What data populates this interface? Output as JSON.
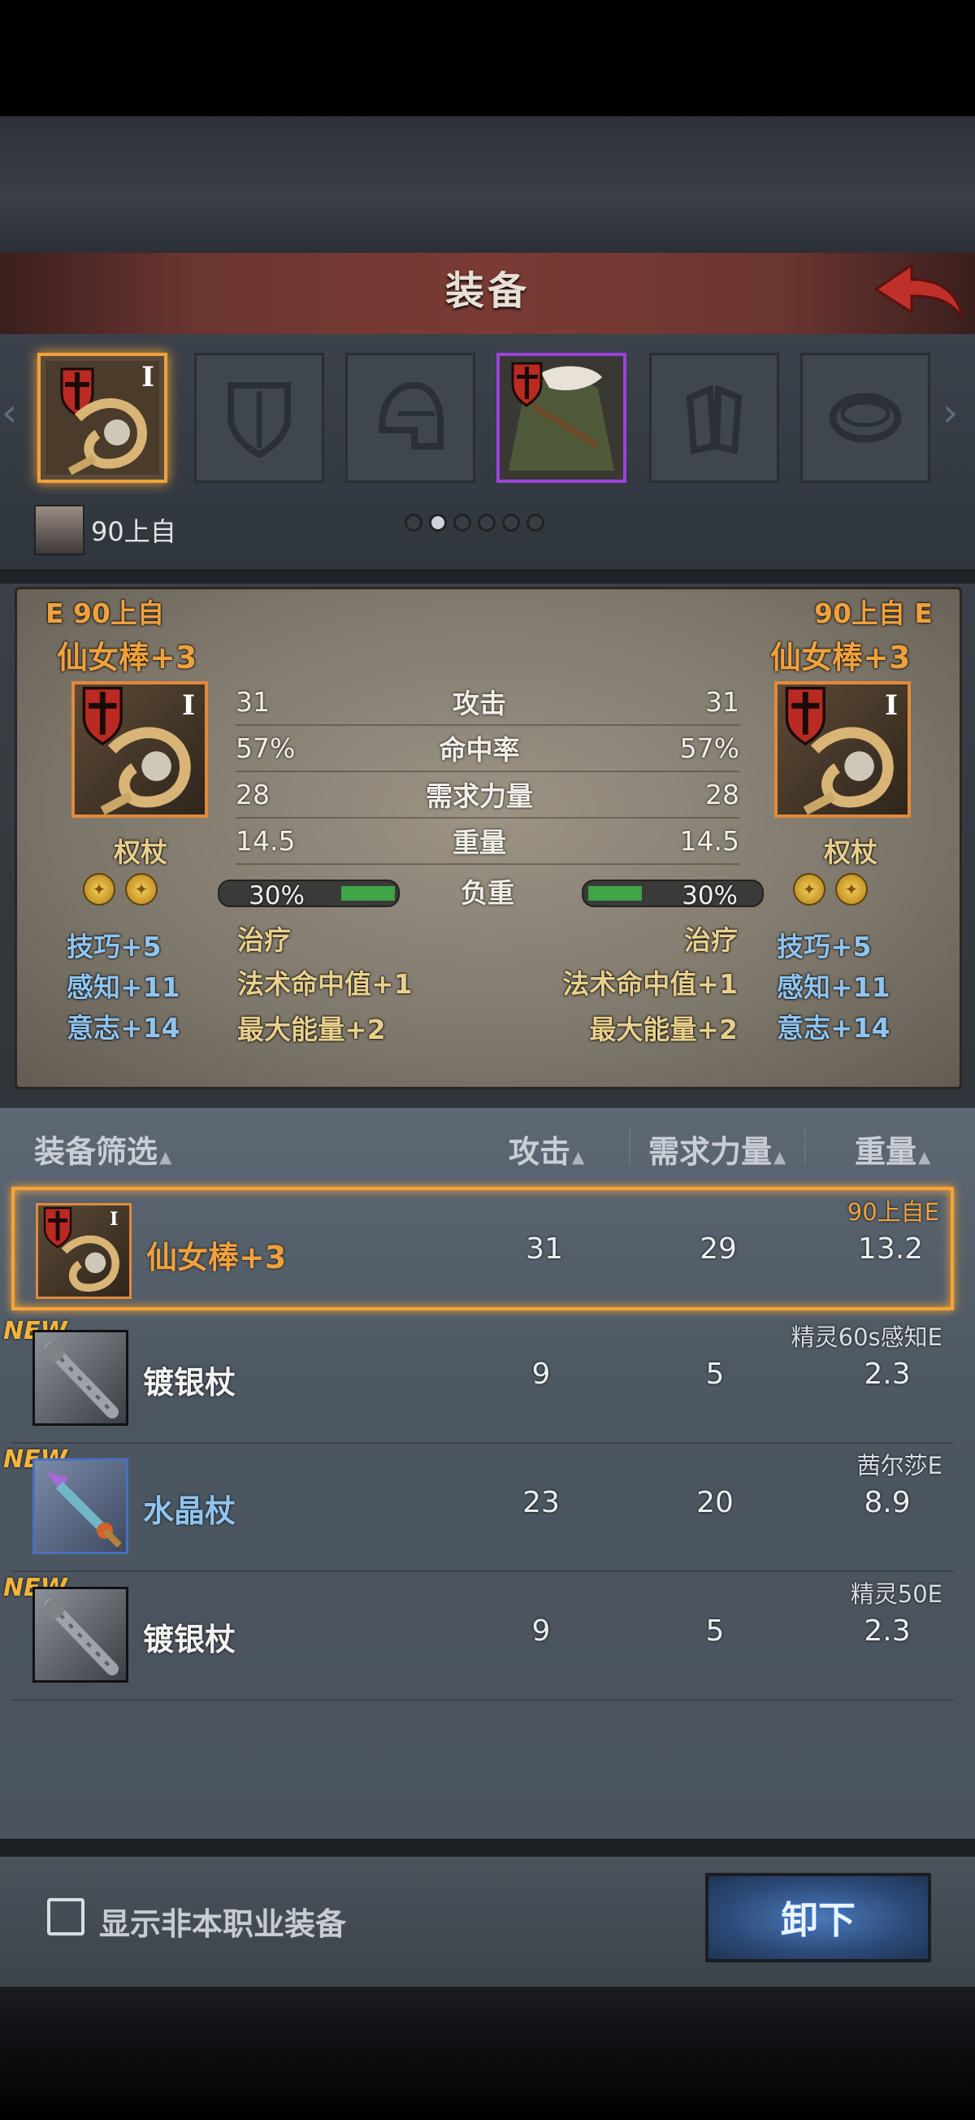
{
  "header": {
    "title": "装备"
  },
  "slots": [
    {
      "roman": "I",
      "state": "selected-orange",
      "icon": "fairy-wand-icon"
    },
    {
      "state": "empty",
      "icon": "shield-slot-icon"
    },
    {
      "state": "empty",
      "icon": "helmet-slot-icon"
    },
    {
      "state": "selected-purple",
      "icon": "fur-coat-armor-icon"
    },
    {
      "state": "empty",
      "icon": "gloves-slot-icon"
    },
    {
      "state": "empty",
      "icon": "ring-slot-icon"
    }
  ],
  "owner": {
    "name": "90上自"
  },
  "compare": {
    "left": {
      "grade_owner": "E 90上自",
      "name": "仙女棒+3",
      "type": "权杖",
      "roman": "I",
      "bonuses": [
        "技巧+5",
        "感知+11",
        "意志+14"
      ]
    },
    "right": {
      "grade_owner": "90上自 E",
      "name": "仙女棒+3",
      "type": "权杖",
      "roman": "I",
      "bonuses": [
        "技巧+5",
        "感知+11",
        "意志+14"
      ]
    },
    "stats": [
      {
        "label": "攻击",
        "left": "31",
        "right": "31"
      },
      {
        "label": "命中率",
        "left": "57%",
        "right": "57%"
      },
      {
        "label": "需求力量",
        "left": "28",
        "right": "28"
      },
      {
        "label": "重量",
        "left": "14.5",
        "right": "14.5"
      }
    ],
    "load": {
      "label": "负重",
      "left": "30%",
      "right": "30%",
      "left_fraction": 0.3,
      "right_fraction": 0.3
    },
    "effects_left": [
      "治疗",
      "法术命中值+1",
      "最大能量+2"
    ],
    "effects_right": [
      "治疗",
      "法术命中值+1",
      "最大能量+2"
    ]
  },
  "list_header": {
    "filter": "装备筛选",
    "attack": "攻击",
    "strength": "需求力量",
    "weight": "重量"
  },
  "items": [
    {
      "name": "仙女棒+3",
      "attack": "31",
      "strength": "29",
      "weight": "13.2",
      "owner": "90上自E",
      "new": "",
      "selected": true,
      "icon": "fairy-wand-icon"
    },
    {
      "name": "镀银杖",
      "attack": "9",
      "strength": "5",
      "weight": "2.3",
      "owner": "精灵60s感知E",
      "new": "NEW",
      "selected": false,
      "icon": "silver-staff-icon"
    },
    {
      "name": "水晶杖",
      "attack": "23",
      "strength": "20",
      "weight": "8.9",
      "owner": "茜尔莎E",
      "new": "NEW",
      "selected": false,
      "icon": "crystal-staff-icon"
    },
    {
      "name": "镀银杖",
      "attack": "9",
      "strength": "5",
      "weight": "2.3",
      "owner": "精灵50E",
      "new": "NEW",
      "selected": false,
      "icon": "silver-staff-icon"
    }
  ],
  "footer": {
    "checkbox_label": "显示非本职业装备",
    "unequip_label": "卸下"
  }
}
